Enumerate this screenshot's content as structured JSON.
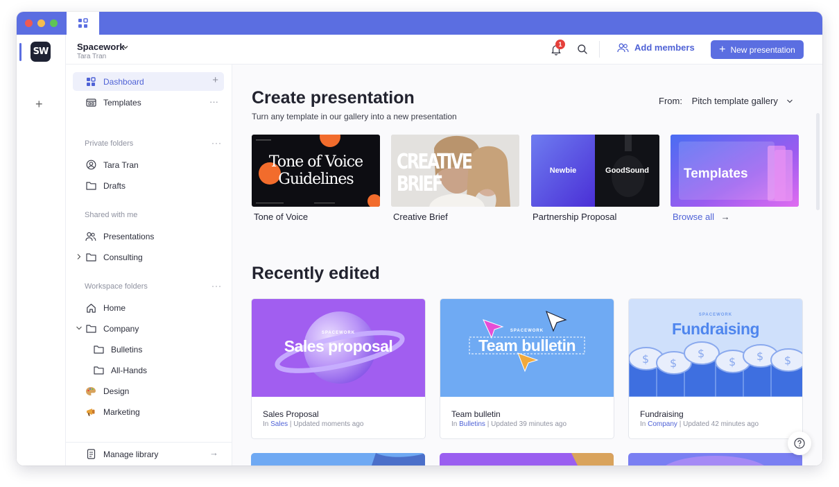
{
  "header": {
    "workspace_name": "Spacework",
    "workspace_user": "Tara Tran",
    "notification_count": "1",
    "add_members_label": "Add members",
    "new_presentation_label": "New presentation"
  },
  "rail": {
    "logo_text": "SW"
  },
  "sidebar": {
    "dashboard": "Dashboard",
    "templates": "Templates",
    "private_folders": "Private folders",
    "tara_tran": "Tara Tran",
    "drafts": "Drafts",
    "shared_with_me": "Shared with me",
    "presentations": "Presentations",
    "consulting": "Consulting",
    "workspace_folders": "Workspace folders",
    "home": "Home",
    "company": "Company",
    "bulletins": "Bulletins",
    "all_hands": "All-Hands",
    "design": "Design",
    "marketing": "Marketing",
    "manage_library": "Manage library"
  },
  "create": {
    "title": "Create presentation",
    "subtitle": "Turn any template in our gallery into a new presentation",
    "from_label": "From:",
    "from_value": "Pitch template gallery",
    "templates": [
      {
        "label": "Tone of Voice",
        "art_line1": "Tone of Voice",
        "art_line2": "Guidelines"
      },
      {
        "label": "Creative Brief",
        "art_line1": "CREATIVE",
        "art_line2": "BRIEF"
      },
      {
        "label": "Partnership Proposal",
        "art_left": "Newbie",
        "art_right": "GoodSound"
      },
      {
        "art": "Templates"
      }
    ],
    "browse_all": "Browse all"
  },
  "recent": {
    "title": "Recently edited",
    "cards": [
      {
        "name": "Sales Proposal",
        "art": "Sales proposal",
        "brand": "SPACEWORK",
        "in_prefix": "In",
        "folder": "Sales",
        "updated": "| Updated moments ago"
      },
      {
        "name": "Team bulletin",
        "art": "Team bulletin",
        "brand": "SPACEWORK",
        "in_prefix": "In",
        "folder": "Bulletins",
        "updated": "| Updated 39 minutes ago"
      },
      {
        "name": "Fundraising",
        "art": "Fundraising",
        "brand": "SPACEWORK",
        "in_prefix": "In",
        "folder": "Company",
        "updated": "| Updated 42 minutes ago"
      }
    ]
  },
  "colors": {
    "accent": "#5b6ee1",
    "link": "#4f62d6",
    "sales_bg": "#a15ef0",
    "bulletin_bg": "#6faaf3",
    "fundraising_bg": "#cfe0fb"
  }
}
